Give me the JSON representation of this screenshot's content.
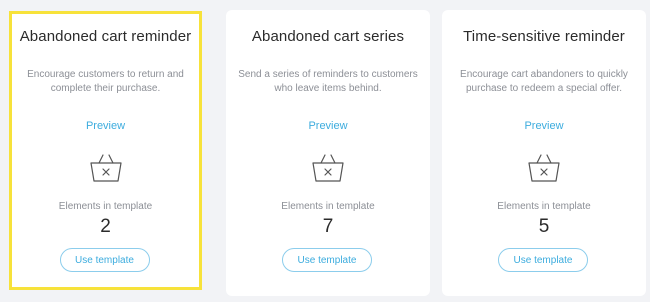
{
  "cards": [
    {
      "title": "Abandoned cart reminder",
      "description_line1": "Encourage customers to return and",
      "description_line2": "complete their purchase.",
      "preview_label": "Preview",
      "elements_label": "Elements in template",
      "elements_count": "2",
      "use_label": "Use template",
      "selected": true
    },
    {
      "title": "Abandoned cart series",
      "description_line1": "Send a series of reminders to customers",
      "description_line2": "who leave items behind.",
      "preview_label": "Preview",
      "elements_label": "Elements in template",
      "elements_count": "7",
      "use_label": "Use template",
      "selected": false
    },
    {
      "title": "Time-sensitive reminder",
      "description_line1": "Encourage cart abandoners to quickly",
      "description_line2": "purchase to redeem a special offer.",
      "preview_label": "Preview",
      "elements_label": "Elements in template",
      "elements_count": "5",
      "use_label": "Use template",
      "selected": false
    }
  ],
  "colors": {
    "background": "#f2f3f6",
    "card": "#ffffff",
    "selected_outline": "#f7e23a",
    "accent": "#3cacde",
    "muted_text": "#8c8f96",
    "primary_text": "#2b2b2b"
  },
  "icons": {
    "card_icon": "basket-icon"
  }
}
